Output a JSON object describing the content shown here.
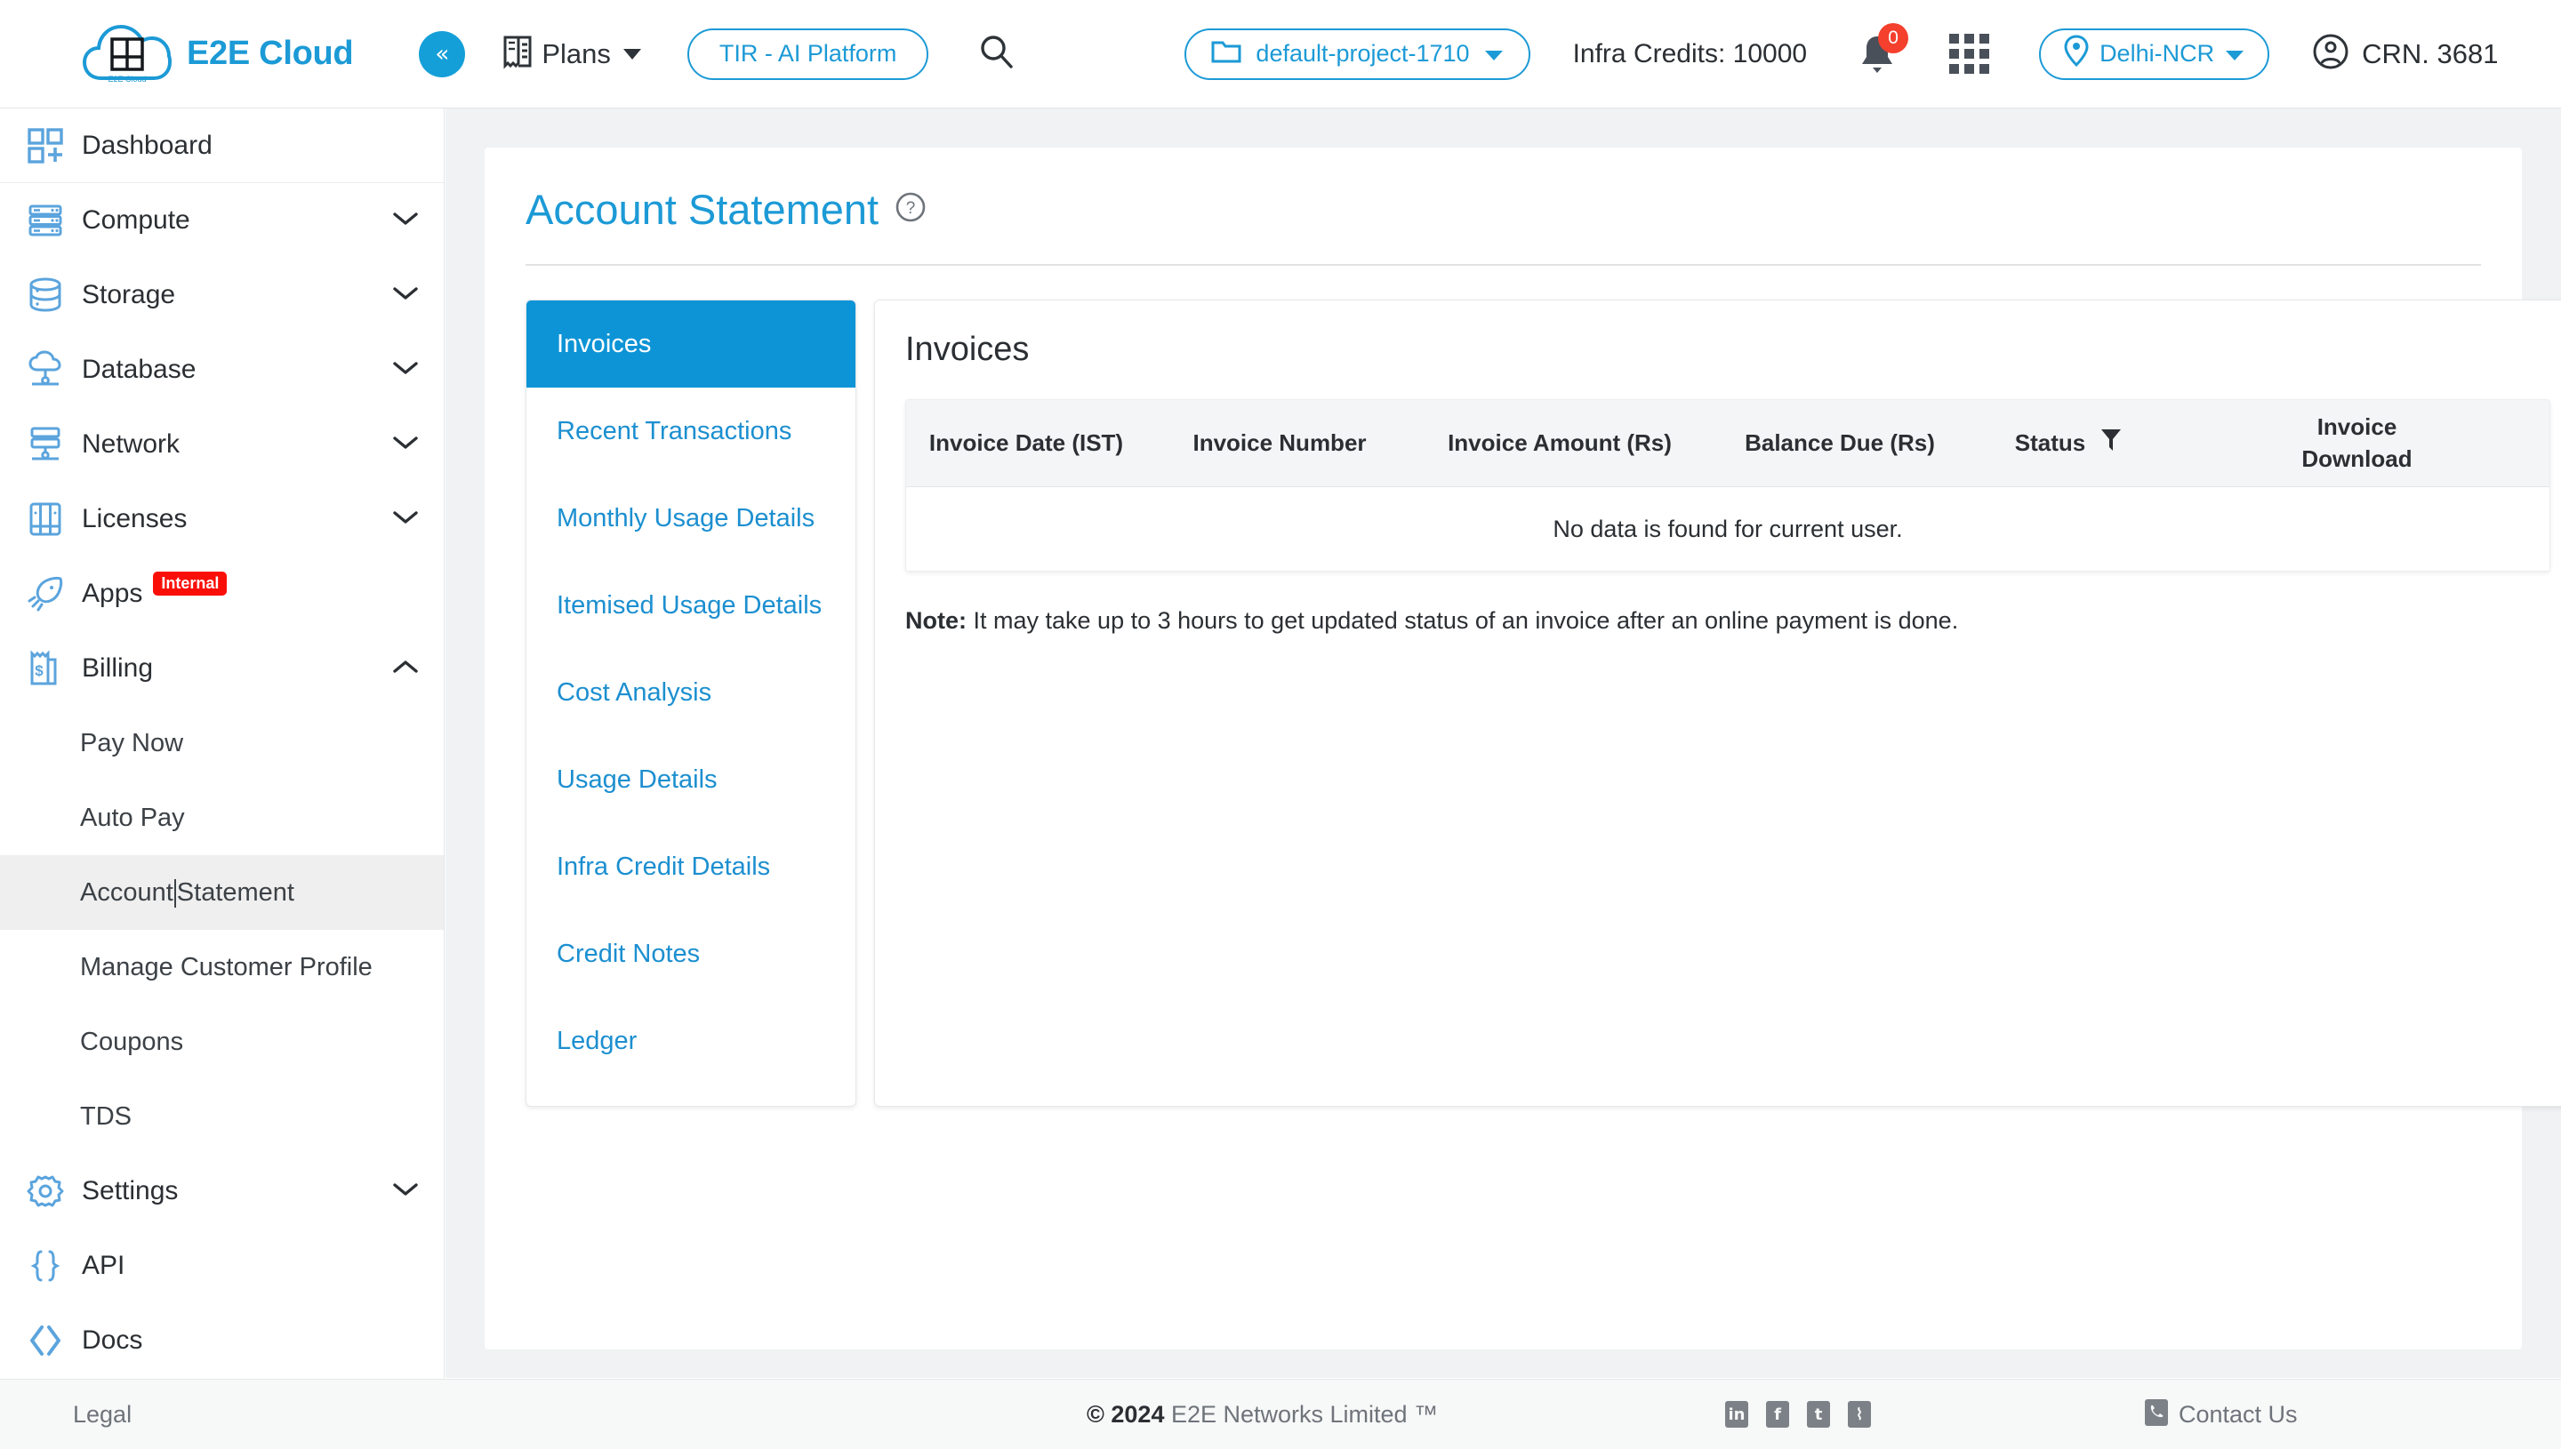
{
  "header": {
    "brand": "E2E Cloud",
    "logo_inner_text": "E2E Cloud",
    "collapse_label": "«",
    "plans_label": "Plans",
    "tir_label": "TIR - AI Platform",
    "search_icon": "search-icon",
    "project_label": "default-project-1710",
    "infra_credits": "Infra Credits: 10000",
    "notification_count": "0",
    "region_label": "Delhi-NCR",
    "crn_label": "CRN. 3681"
  },
  "sidebar": {
    "items": [
      {
        "label": "Dashboard",
        "icon": "dashboard-icon",
        "expandable": false
      },
      {
        "label": "Compute",
        "icon": "server-icon",
        "expandable": true,
        "expanded": false
      },
      {
        "label": "Storage",
        "icon": "database-stack-icon",
        "expandable": true,
        "expanded": false
      },
      {
        "label": "Database",
        "icon": "cloud-database-icon",
        "expandable": true,
        "expanded": false
      },
      {
        "label": "Network",
        "icon": "network-icon",
        "expandable": true,
        "expanded": false
      },
      {
        "label": "Licenses",
        "icon": "license-grid-icon",
        "expandable": true,
        "expanded": false
      },
      {
        "label": "Apps",
        "icon": "rocket-icon",
        "expandable": false,
        "badge": "Internal"
      },
      {
        "label": "Billing",
        "icon": "billing-receipt-icon",
        "expandable": true,
        "expanded": true
      }
    ],
    "billing_children": [
      {
        "label": "Pay Now",
        "active": false
      },
      {
        "label": "Auto Pay",
        "active": false
      },
      {
        "label": "Account Statement",
        "active": true,
        "caret_after": "Account"
      },
      {
        "label": "Manage Customer Profile",
        "active": false
      },
      {
        "label": "Coupons",
        "active": false
      },
      {
        "label": "TDS",
        "active": false
      }
    ],
    "bottom_items": [
      {
        "label": "Settings",
        "icon": "gear-icon",
        "expandable": true
      },
      {
        "label": "API",
        "icon": "braces-icon",
        "expandable": false
      },
      {
        "label": "Docs",
        "icon": "code-angle-icon",
        "expandable": false
      }
    ]
  },
  "main": {
    "page_title": "Account Statement",
    "help_icon": "question-circle-icon",
    "tabs": [
      {
        "label": "Invoices",
        "active": true
      },
      {
        "label": "Recent Transactions",
        "active": false
      },
      {
        "label": "Monthly Usage Details",
        "active": false
      },
      {
        "label": "Itemised Usage Details",
        "active": false
      },
      {
        "label": "Cost Analysis",
        "active": false
      },
      {
        "label": "Usage Details",
        "active": false
      },
      {
        "label": "Infra Credit Details",
        "active": false
      },
      {
        "label": "Credit Notes",
        "active": false
      },
      {
        "label": "Ledger",
        "active": false
      }
    ],
    "panel_title": "Invoices",
    "table": {
      "columns": [
        "Invoice Date (IST)",
        "Invoice Number",
        "Invoice Amount (Rs)",
        "Balance Due (Rs)",
        "Status",
        "Invoice Download"
      ],
      "status_filter_icon": "filter-icon",
      "empty_message": "No data is found for current user.",
      "rows": []
    },
    "note_prefix": "Note:",
    "note_text": " It may take up to 3 hours to get updated status of an invoice after an online payment is done."
  },
  "footer": {
    "legal": "Legal",
    "copyright_year": "© 2024",
    "copyright_rest": " E2E Networks Limited ™",
    "socials": [
      {
        "name": "linkedin-icon",
        "glyph": "in"
      },
      {
        "name": "facebook-icon",
        "glyph": "f"
      },
      {
        "name": "twitter-icon",
        "glyph": "t"
      },
      {
        "name": "rss-icon",
        "glyph": "⌇"
      }
    ],
    "contact": "Contact Us",
    "contact_icon": "phone-icon"
  },
  "colors": {
    "brand_blue": "#1c9ad6",
    "active_tab_blue": "#0d94d6",
    "badge_red": "#fa0f08",
    "notification_red": "#f4402d",
    "main_bg": "#f0f2f3"
  }
}
